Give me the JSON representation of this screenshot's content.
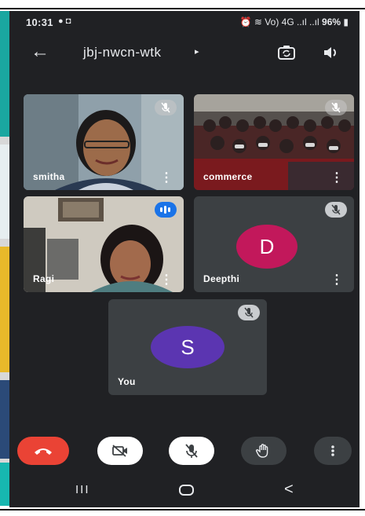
{
  "status_bar": {
    "time": "10:31",
    "left_icons": "● ◘",
    "right_icons": "⏰ ≋ Vo) 4G ..ıl ..ıl",
    "battery": "96%"
  },
  "meeting": {
    "code": "jbj-nwcn-wtk",
    "caret": "▸"
  },
  "participants": [
    {
      "name": "smitha",
      "muted": true,
      "has_video": true
    },
    {
      "name": "commerce",
      "muted": true,
      "has_video": true
    },
    {
      "name": "Ragi",
      "muted": false,
      "speaking": true,
      "has_video": true
    },
    {
      "name": "Deepthi",
      "muted": true,
      "has_video": false,
      "initial": "D",
      "avatar_color": "#c2185b"
    },
    {
      "name": "You",
      "muted": true,
      "has_video": false,
      "initial": "S",
      "avatar_color": "#5b35b1"
    }
  ],
  "icons": {
    "back": "arrow-left-icon",
    "switch_camera": "switch-camera-icon",
    "speaker": "speaker-icon",
    "end_call": "end-call-icon",
    "camera_off": "camera-off-icon",
    "mic_off": "mic-off-icon",
    "raise_hand": "raise-hand-icon",
    "more": "more-vert-icon"
  },
  "colors": {
    "background": "#202124",
    "tile": "#3c4043",
    "end_call": "#ea4335",
    "toggle_off": "#ffffff",
    "speaking": "#1a73e8"
  },
  "nav": {
    "recent": "III",
    "home": "home",
    "back": "<"
  }
}
